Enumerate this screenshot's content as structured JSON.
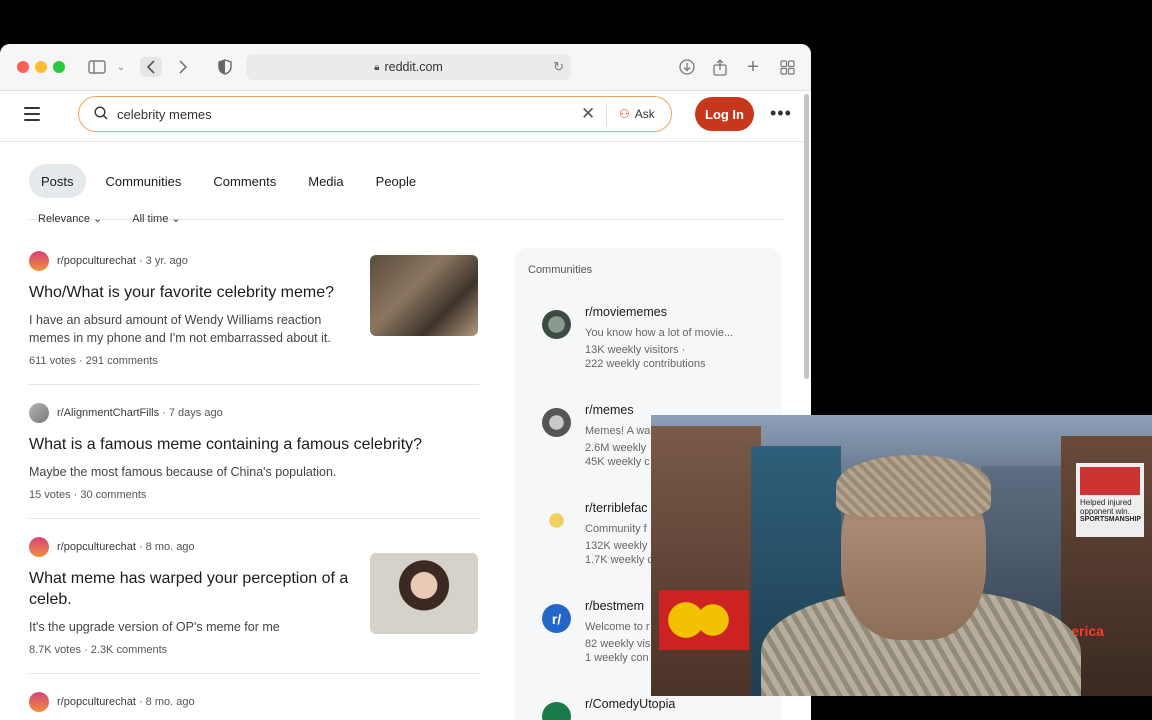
{
  "browser": {
    "url": "reddit.com"
  },
  "header": {
    "search_value": "celebrity memes",
    "ask_label": "Ask",
    "login_label": "Log In"
  },
  "tabs": [
    {
      "label": "Posts"
    },
    {
      "label": "Communities"
    },
    {
      "label": "Comments"
    },
    {
      "label": "Media"
    },
    {
      "label": "People"
    }
  ],
  "filters": {
    "sort": "Relevance",
    "time": "All time"
  },
  "posts": [
    {
      "subreddit": "r/popculturechat",
      "age": "3 yr. ago",
      "title": "Who/What is your favorite celebrity meme?",
      "body": "I have an absurd amount of Wendy Williams reaction memes in my phone and I'm not embarrassed about it.",
      "votes": "611 votes",
      "comments": "291 comments"
    },
    {
      "subreddit": "r/AlignmentChartFills",
      "age": "7 days ago",
      "title": "What is a famous meme containing a famous celebrity?",
      "body": "Maybe the most famous because of China's population.",
      "votes": "15 votes",
      "comments": "30 comments"
    },
    {
      "subreddit": "r/popculturechat",
      "age": "8 mo. ago",
      "title": "What meme has warped your perception of a celeb.",
      "body": "It's the upgrade version of OP's meme for me",
      "votes": "8.7K votes",
      "comments": "2.3K comments"
    },
    {
      "subreddit": "r/popculturechat",
      "age": "8 mo. ago"
    }
  ],
  "sidebar": {
    "heading": "Communities",
    "communities": [
      {
        "name": "r/moviememes",
        "desc": "You know how a lot of movie...",
        "visitors": "13K weekly visitors ·",
        "contributions": "222 weekly contributions"
      },
      {
        "name": "r/memes",
        "desc": "Memes! A wa",
        "visitors": "2.6M weekly",
        "contributions": "45K weekly c"
      },
      {
        "name": "r/terriblefac",
        "desc": "Community f",
        "visitors": "132K weekly",
        "contributions": "1.7K weekly c"
      },
      {
        "name": "r/bestmem",
        "desc": "Welcome to r",
        "visitors": "82 weekly vis",
        "contributions": "1 weekly con"
      },
      {
        "name": "r/ComedyUtopia",
        "desc": "",
        "visitors": "",
        "contributions": ""
      }
    ]
  },
  "webcam": {
    "sign_text": "Helped injured opponent win.",
    "sign_sub": "SPORTSMANSHIP",
    "store_sign": "america"
  },
  "colors": {
    "accent": "#c8361b",
    "search_border": "#f0a45e",
    "active_tab": "#e4e9ec"
  }
}
